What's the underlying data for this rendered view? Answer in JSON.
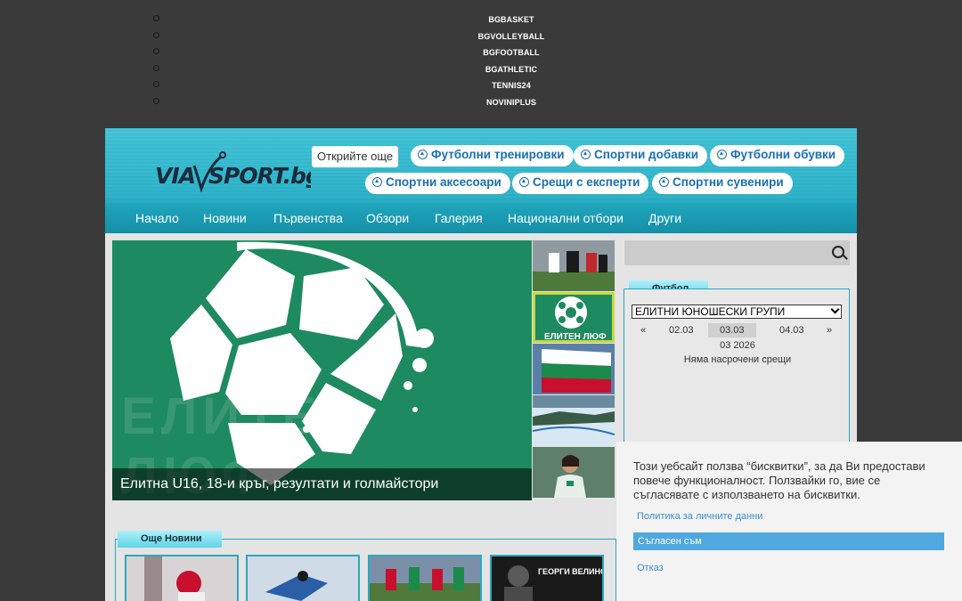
{
  "top_links": [
    "BGBASKET",
    "BGVOLLEYBALL",
    "BGFOOTBALL",
    "BGATHLETIC",
    "TENNIS24",
    "NOVINIPLUS"
  ],
  "header": {
    "logo_text": "VIA SPORT.bg",
    "discover_label": "Открийте още",
    "pills_row1": [
      "Футболни тренировки",
      "Спортни добавки",
      "Футболни обувки"
    ],
    "pills_row2": [
      "Спортни аксесоари",
      "Срещи с експерти",
      "Спортни сувенири"
    ]
  },
  "nav": [
    "Начало",
    "Новини",
    "Първенства",
    "Обзори",
    "Галерия",
    "Национални отбори",
    "Други"
  ],
  "hero": {
    "caption": "Елитна U16, 18-и кръг, резултати и голмайстори",
    "bg_text": "ЕЛИТЕН ЛЮФ"
  },
  "thumbs": [
    {
      "name": "thumb-players",
      "label": ""
    },
    {
      "name": "thumb-elite-league",
      "label": "ЕЛИТЕН ЛЮФ"
    },
    {
      "name": "thumb-flag",
      "label": ""
    },
    {
      "name": "thumb-ski",
      "label": ""
    },
    {
      "name": "thumb-athlete",
      "label": ""
    }
  ],
  "football_widget": {
    "title": "Футбол",
    "selected_group": "ЕЛИТНИ ЮНОШЕСКИ ГРУПИ",
    "prev": "«",
    "next": "»",
    "dates": [
      "02.03",
      "03.03",
      "04.03"
    ],
    "month_year": "03 2026",
    "empty_text": "Няма насрочени срещи"
  },
  "more_news": {
    "title": "Още Новини",
    "items": [
      "",
      "",
      "",
      "ГЕОРГИ ВЕЛИНОВ"
    ]
  },
  "cookie": {
    "text": "Този уебсайт ползва “бисквитки”, за да Ви предостави повече функционалност. Ползвайки го, вие се съгласявате с използването на бисквитки.",
    "policy_link": "Политика за личните данни",
    "accept": "Съгласен съм",
    "deny": "Отказ"
  },
  "colors": {
    "header": "#2bb2c8",
    "hero_green": "#1e8a5f",
    "pill_text": "#1a6fb5",
    "accept_button": "#4fa9e0"
  }
}
